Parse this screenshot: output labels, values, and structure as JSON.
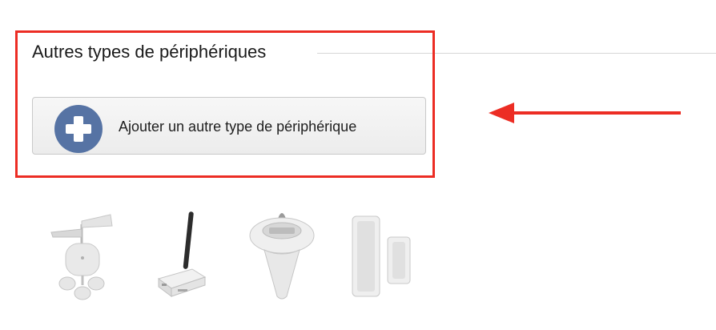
{
  "section": {
    "title": "Autres types de périphériques"
  },
  "add_button": {
    "label": "Ajouter un autre type de périphérique",
    "icon": "plus-circle-icon"
  },
  "annotation": {
    "highlight_color": "#ec2d24",
    "arrow_color": "#ec2d24",
    "arrow_direction": "left"
  },
  "devices": [
    {
      "name": "weather-vane-icon"
    },
    {
      "name": "gateway-antenna-icon"
    },
    {
      "name": "pool-sensor-icon"
    },
    {
      "name": "weather-station-icon"
    }
  ],
  "colors": {
    "accent_blue": "#5673a4",
    "title_rule": "#d6d6d6"
  }
}
